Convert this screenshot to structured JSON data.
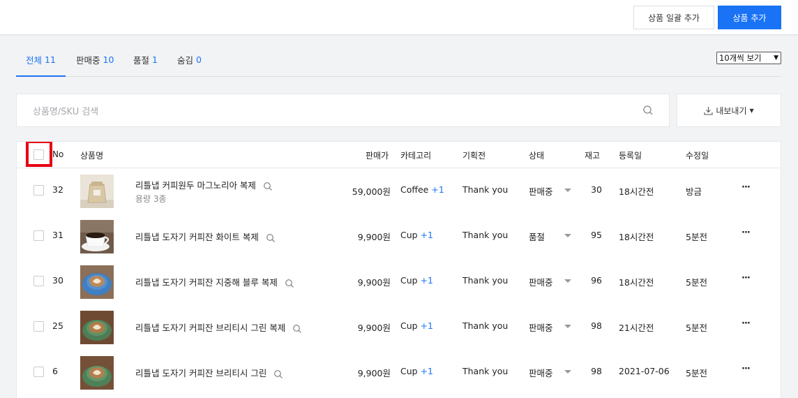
{
  "header": {
    "bulk_add_label": "상품 일괄 추가",
    "add_label": "상품 추가"
  },
  "tabs": [
    {
      "label": "전체",
      "count": "11"
    },
    {
      "label": "판매중",
      "count": "10"
    },
    {
      "label": "품절",
      "count": "1"
    },
    {
      "label": "숨김",
      "count": "0"
    }
  ],
  "per_page": "10개씩 보기",
  "search": {
    "placeholder": "상품명/SKU 검색"
  },
  "export_label": "내보내기",
  "table": {
    "headers": {
      "no": "No",
      "name": "상품명",
      "price": "판매가",
      "category": "카테고리",
      "exhibition": "기획전",
      "status": "상태",
      "stock": "재고",
      "registered": "등록일",
      "modified": "수정일"
    },
    "rows": [
      {
        "no": "32",
        "name": "리틀냅 커피원두 마그노리아 복제",
        "option": "용량 3종",
        "price": "59,000원",
        "category": "Coffee",
        "category_extra": "+1",
        "exhibition": "Thank you",
        "status": "판매중",
        "stock": "30",
        "registered": "18시간전",
        "modified": "방금"
      },
      {
        "no": "31",
        "name": "리틀냅 도자기 커피잔 화이트 복제",
        "option": "",
        "price": "9,900원",
        "category": "Cup",
        "category_extra": "+1",
        "exhibition": "Thank you",
        "status": "품절",
        "stock": "95",
        "registered": "18시간전",
        "modified": "5분전"
      },
      {
        "no": "30",
        "name": "리틀냅 도자기 커피잔 지중해 블루 복제",
        "option": "",
        "price": "9,900원",
        "category": "Cup",
        "category_extra": "+1",
        "exhibition": "Thank you",
        "status": "판매중",
        "stock": "96",
        "registered": "18시간전",
        "modified": "5분전"
      },
      {
        "no": "25",
        "name": "리틀냅 도자기 커피잔 브리티시 그린 복제",
        "option": "",
        "price": "9,900원",
        "category": "Cup",
        "category_extra": "+1",
        "exhibition": "Thank you",
        "status": "판매중",
        "stock": "98",
        "registered": "21시간전",
        "modified": "5분전"
      },
      {
        "no": "6",
        "name": "리틀냅 도자기 커피잔 브리티시 그린",
        "option": "",
        "price": "9,900원",
        "category": "Cup",
        "category_extra": "+1",
        "exhibition": "Thank you",
        "status": "판매중",
        "stock": "98",
        "registered": "2021-07-06",
        "modified": "5분전"
      }
    ]
  },
  "colors": {
    "accent": "#1a73f5",
    "highlight": "#e60012"
  }
}
